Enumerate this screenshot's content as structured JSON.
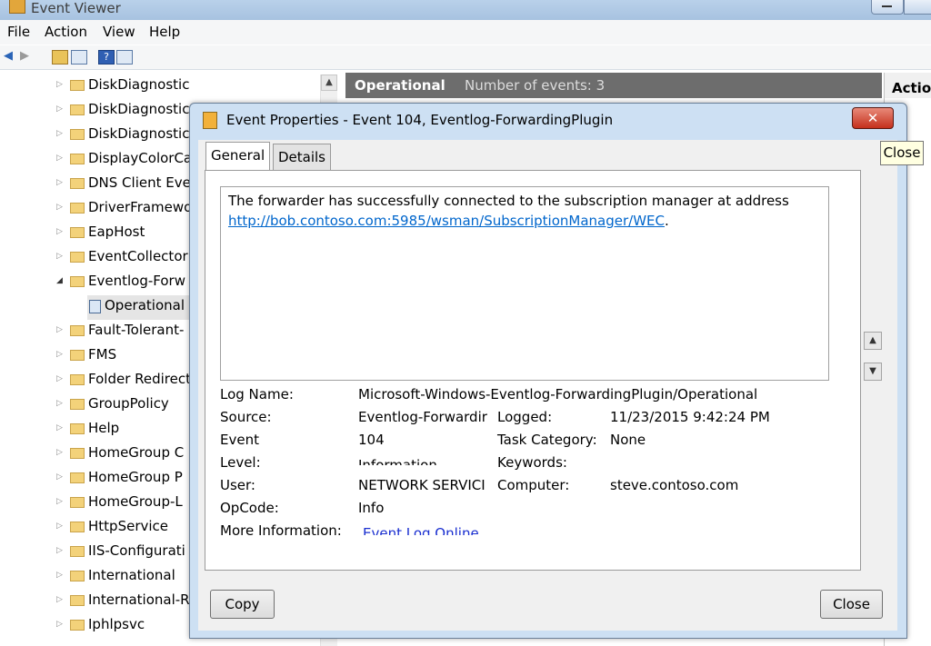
{
  "window": {
    "title": "Event Viewer"
  },
  "menu": [
    "File",
    "Action",
    "View",
    "Help"
  ],
  "tree": {
    "items": [
      {
        "label": "DiskDiagnostic",
        "expanded": false
      },
      {
        "label": "DiskDiagnostic",
        "expanded": false
      },
      {
        "label": "DiskDiagnostic",
        "expanded": false
      },
      {
        "label": "DisplayColorCa",
        "expanded": false
      },
      {
        "label": "DNS Client Eve",
        "expanded": false
      },
      {
        "label": "DriverFramewo",
        "expanded": false
      },
      {
        "label": "EapHost",
        "expanded": false
      },
      {
        "label": "EventCollector",
        "expanded": false
      },
      {
        "label": "Eventlog-Forw",
        "expanded": true
      },
      {
        "label": "Operational",
        "child": true
      },
      {
        "label": "Fault-Tolerant-",
        "expanded": false
      },
      {
        "label": "FMS",
        "expanded": false
      },
      {
        "label": "Folder Redirect",
        "expanded": false
      },
      {
        "label": "GroupPolicy",
        "expanded": false
      },
      {
        "label": "Help",
        "expanded": false
      },
      {
        "label": "HomeGroup C",
        "expanded": false
      },
      {
        "label": "HomeGroup P",
        "expanded": false
      },
      {
        "label": "HomeGroup-L",
        "expanded": false
      },
      {
        "label": "HttpService",
        "expanded": false
      },
      {
        "label": "IIS-Configurati",
        "expanded": false
      },
      {
        "label": "International",
        "expanded": false
      },
      {
        "label": "International-R",
        "expanded": false
      },
      {
        "label": "Iphlpsvc",
        "expanded": false
      }
    ]
  },
  "center": {
    "title": "Operational",
    "count_text": "Number of events: 3"
  },
  "actions": {
    "header": "Actio"
  },
  "dialog": {
    "title": "Event Properties - Event 104, Eventlog-ForwardingPlugin",
    "close_tooltip": "Close",
    "tabs": [
      "General",
      "Details"
    ],
    "description_text": "The forwarder has successfully connected to the subscription manager at address",
    "description_link": "http://bob.contoso.com:5985/wsman/SubscriptionManager/WEC",
    "description_end": ".",
    "fields": {
      "log_name_label": "Log Name:",
      "log_name": "Microsoft-Windows-Eventlog-ForwardingPlugin/Operational",
      "source_label": "Source:",
      "source": "Eventlog-Forwardir",
      "logged_label": "Logged:",
      "logged": "11/23/2015 9:42:24 PM",
      "event_label": "Event",
      "event": "104",
      "task_label": "Task Category:",
      "task": "None",
      "level_label": "Level:",
      "level": "Information",
      "keywords_label": "Keywords:",
      "keywords": "",
      "user_label": "User:",
      "user": "NETWORK SERVICI",
      "computer_label": "Computer:",
      "computer": "steve.contoso.com",
      "opcode_label": "OpCode:",
      "opcode": "Info",
      "more_label": "More Information:",
      "more_link": "Event Log Online"
    },
    "copy_label": "Copy",
    "close_label": "Close"
  }
}
